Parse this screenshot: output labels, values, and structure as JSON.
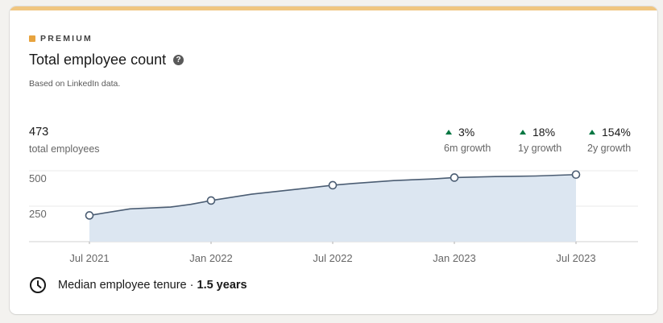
{
  "premium": {
    "label": "PREMIUM",
    "color": "#e7a33e",
    "bar_color": "#f0c680"
  },
  "title": "Total employee count",
  "source": "Based on LinkedIn data.",
  "summary": {
    "value": "473",
    "label": "total employees"
  },
  "growth": [
    {
      "value": "3%",
      "label": "6m growth"
    },
    {
      "value": "18%",
      "label": "1y growth"
    },
    {
      "value": "154%",
      "label": "2y growth"
    }
  ],
  "growth_color": "#057642",
  "chart_data": {
    "type": "area",
    "x": [
      "2021-07",
      "2021-09",
      "2021-11",
      "2021-12",
      "2022-01",
      "2022-03",
      "2022-05",
      "2022-07",
      "2022-08",
      "2022-10",
      "2022-12",
      "2023-01",
      "2023-03",
      "2023-05",
      "2023-07"
    ],
    "values": [
      185,
      231,
      244,
      263,
      290,
      335,
      366,
      398,
      410,
      431,
      443,
      452,
      459,
      463,
      473
    ],
    "marked_points": [
      "2021-07",
      "2022-01",
      "2022-07",
      "2023-01",
      "2023-07"
    ],
    "xticks": [
      "Jul 2021",
      "Jan 2022",
      "Jul 2022",
      "Jan 2023",
      "Jul 2023"
    ],
    "yticks": [
      "250",
      "500"
    ],
    "ylim": [
      0,
      500
    ],
    "line_color": "#4b5d73",
    "fill_color": "#dce6f1",
    "grid": true
  },
  "footer": {
    "text": "Median employee tenure · ",
    "value": "1.5 years"
  }
}
